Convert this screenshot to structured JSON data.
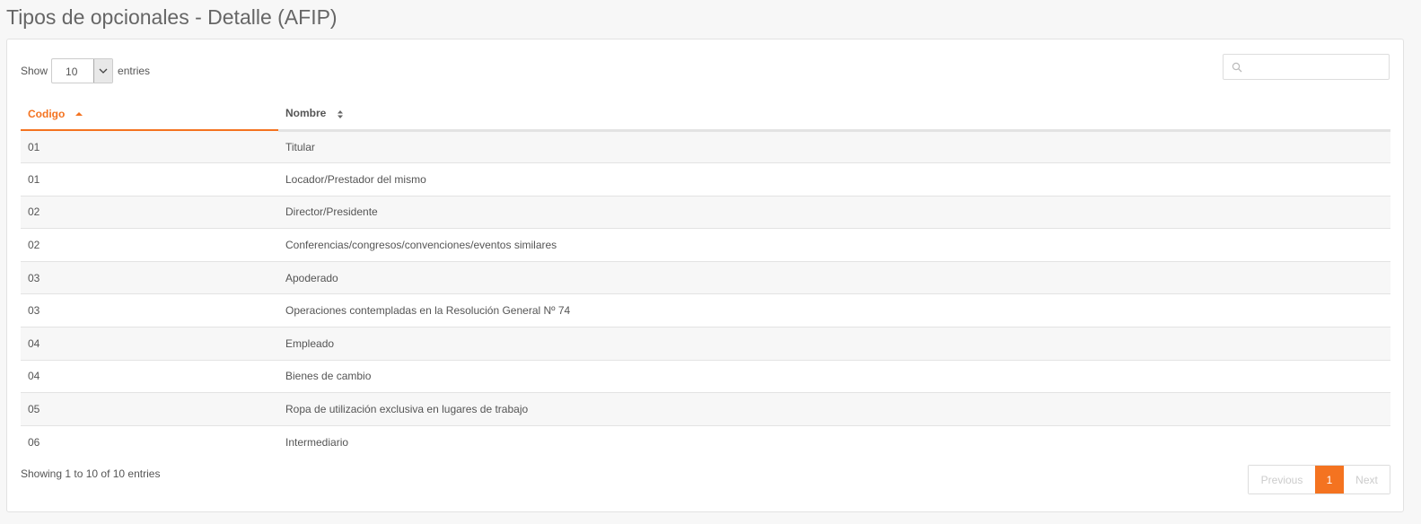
{
  "page": {
    "title": "Tipos de opcionales - Detalle (AFIP)"
  },
  "length_control": {
    "show_label": "Show",
    "selected_value": "10",
    "entries_label": "entries"
  },
  "search": {
    "placeholder": "",
    "icon": "search-icon"
  },
  "table": {
    "columns": [
      "Codigo",
      "Nombre"
    ],
    "sorted_column": "Codigo",
    "sort_direction": "ascending",
    "rows": [
      {
        "codigo": "01",
        "nombre": "Titular"
      },
      {
        "codigo": "01",
        "nombre": "Locador/Prestador del mismo"
      },
      {
        "codigo": "02",
        "nombre": "Director/Presidente"
      },
      {
        "codigo": "02",
        "nombre": "Conferencias/congresos/convenciones/eventos similares"
      },
      {
        "codigo": "03",
        "nombre": "Apoderado"
      },
      {
        "codigo": "03",
        "nombre": "Operaciones contempladas en la Resolución General Nº 74"
      },
      {
        "codigo": "04",
        "nombre": "Empleado"
      },
      {
        "codigo": "04",
        "nombre": "Bienes de cambio"
      },
      {
        "codigo": "05",
        "nombre": "Ropa de utilización exclusiva en lugares de trabajo"
      },
      {
        "codigo": "06",
        "nombre": "Intermediario"
      }
    ]
  },
  "footer": {
    "info": "Showing 1 to 10 of 10 entries"
  },
  "pagination": {
    "previous_label": "Previous",
    "current_page": "1",
    "next_label": "Next"
  },
  "colors": {
    "accent": "#f47320",
    "row_stripe": "#f7f7f7",
    "text": "#555555"
  }
}
